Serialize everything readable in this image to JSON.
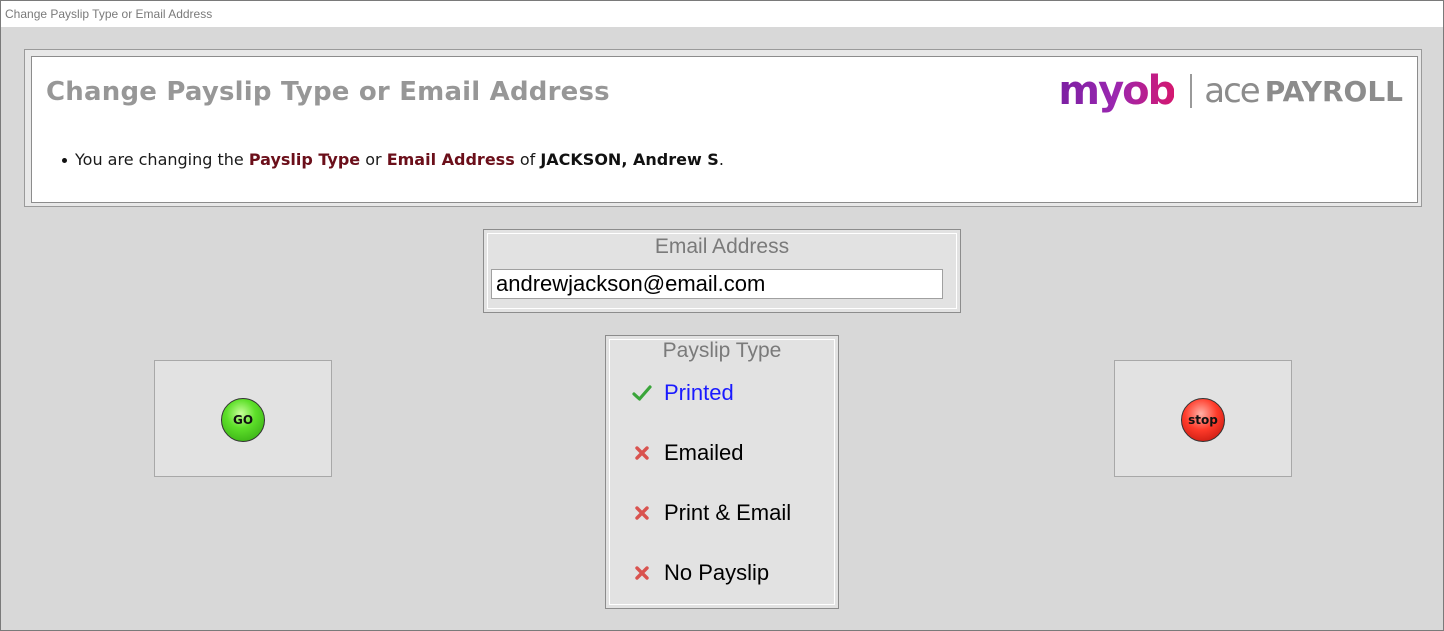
{
  "window": {
    "title": "Change Payslip Type or Email Address"
  },
  "header": {
    "title": "Change Payslip Type or Email Address",
    "logo": {
      "brand": "myob",
      "product_ace": "ace",
      "product_payroll": "PAYROLL"
    },
    "notice": {
      "prefix": "You are changing the",
      "payslip_type": "Payslip Type",
      "or": "or",
      "email_address": "Email Address",
      "of": "of",
      "employee": "JACKSON, Andrew S",
      "suffix": "."
    }
  },
  "email": {
    "label": "Email Address",
    "value": "andrewjackson@email.com"
  },
  "payslip_type": {
    "label": "Payslip Type",
    "options": [
      {
        "label": "Printed",
        "selected": true
      },
      {
        "label": "Emailed",
        "selected": false
      },
      {
        "label": "Print & Email",
        "selected": false
      },
      {
        "label": "No Payslip",
        "selected": false
      }
    ]
  },
  "buttons": {
    "go_label": "GO",
    "stop_label": "stop"
  },
  "colors": {
    "selected_text": "#1a1aff",
    "check": "#3aa53a",
    "cross": "#d9534f",
    "highlight": "#6b0f1a"
  }
}
